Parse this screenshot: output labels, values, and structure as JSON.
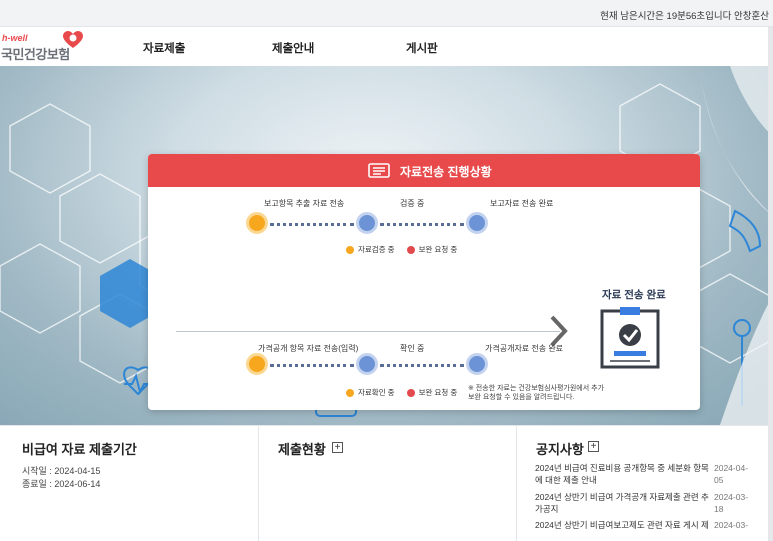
{
  "session": {
    "text": "현재 남은시간은 19분56초입니다  안창훈산"
  },
  "logo": {
    "sub": "h-well",
    "main": "국민건강보험"
  },
  "nav": [
    {
      "label": "자료제출"
    },
    {
      "label": "제출안내"
    },
    {
      "label": "게시판"
    }
  ],
  "progress": {
    "title": "자료전송 진행상황",
    "row1": {
      "steps": [
        "보고항목 추출 자료 전송",
        "검증 중",
        "보고자료 전송 완료"
      ],
      "legend": [
        "자료검증 중",
        "보완 요청 중"
      ]
    },
    "row2": {
      "steps": [
        "가격공개 항목 자료 전송(입력)",
        "확인 중",
        "가격공개자료 전송 완료"
      ],
      "legend": [
        "자료확인 중",
        "보완 요청 중"
      ]
    },
    "note": "※ 전송한 자료는 건강보험심사평가원에서 추가 보완 요청할 수 있음을 알려드립니다.",
    "complete": "자료 전송 완료"
  },
  "period": {
    "title": "비급여 자료 제출기간",
    "start": "시작일 : 2024-04-15",
    "end": "종료일 : 2024-06-14"
  },
  "status": {
    "title": "제출현황"
  },
  "notices": {
    "title": "공지사항",
    "items": [
      {
        "title": "2024년 비급여 진료비용 공개항목 중 세분화 항목에 대한 제출 안내",
        "date": "2024-04-05"
      },
      {
        "title": "2024년 상반기 비급여 가격공개 자료제출 관련 추가공지",
        "date": "2024-03-18"
      },
      {
        "title": "2024년 상반기 비급여보고제도 관련 자료 게시 제",
        "date": "2024-03-"
      }
    ]
  },
  "colors": {
    "accent": "#e8494b",
    "orange": "#f6a71e",
    "blue": "#6b93d6"
  }
}
